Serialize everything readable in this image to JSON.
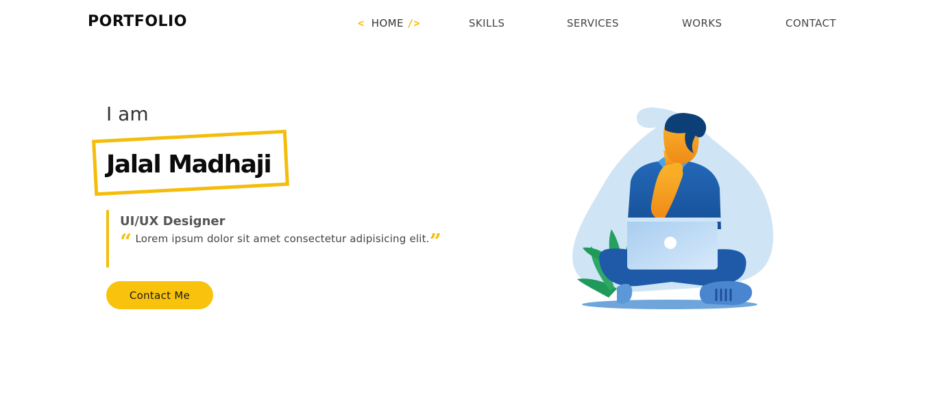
{
  "header": {
    "logo": "PORTFOLIO",
    "nav": [
      {
        "label": "HOME",
        "active": true,
        "prefix": "<",
        "suffix": "/>"
      },
      {
        "label": "SKILLS"
      },
      {
        "label": "SERVICES"
      },
      {
        "label": "WORKS"
      },
      {
        "label": "CONTACT"
      }
    ]
  },
  "hero": {
    "intro": "I am",
    "name": "Jalal Madhaji",
    "role": "UI/UX Designer",
    "quote": "Lorem ipsum dolor sit amet consectetur adipisicing elit.",
    "cta_label": "Contact Me"
  },
  "colors": {
    "accent": "#f5bd0b",
    "button": "#f9c20c",
    "illustration_blob": "#cfe5f6",
    "shirt": "#1f5fae",
    "skin": "#f6a623",
    "hair": "#0b3f75",
    "leaves": "#2fa866"
  },
  "icons": {
    "open_quote": "quote-open-icon",
    "close_quote": "quote-close-icon",
    "nav_home_prefix": "chevron-left-icon",
    "nav_home_suffix": "slash-close-tag-icon"
  }
}
